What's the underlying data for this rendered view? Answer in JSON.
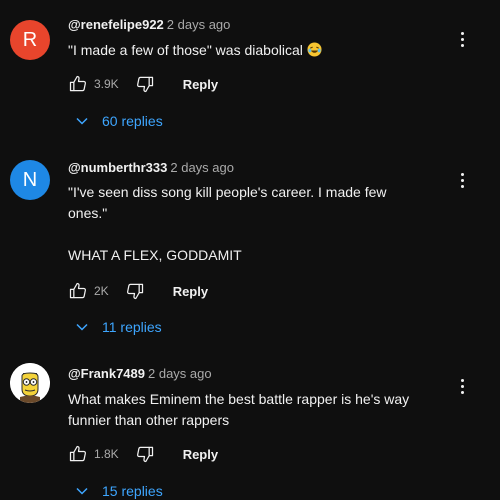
{
  "comments": [
    {
      "avatar_letter": "R",
      "avatar_color": "#e8452c",
      "handle": "@renefelipe922",
      "time": "2 days ago",
      "text_lines": [
        "\"I made a few of those\" was diabolical"
      ],
      "emoji": "laughing-face-icon",
      "likes": "3.9K",
      "reply_label": "Reply",
      "replies_label": "60 replies"
    },
    {
      "avatar_letter": "N",
      "avatar_color": "#1e88e5",
      "handle": "@numberthr333",
      "time": "2 days ago",
      "text_lines": [
        "\"I've seen diss song kill people's career. I made few",
        "ones.\""
      ],
      "text_extra": "WHAT A FLEX, GODDAMIT",
      "likes": "2K",
      "reply_label": "Reply",
      "replies_label": "11 replies"
    },
    {
      "avatar_image": "cartoon-character-avatar",
      "handle": "@Frank7489",
      "time": "2 days ago",
      "text_lines": [
        "What makes Eminem the best battle rapper is he's way",
        "funnier than other rappers"
      ],
      "likes": "1.8K",
      "reply_label": "Reply",
      "replies_label": "15 replies"
    }
  ],
  "colors": {
    "background": "#0f0f0f",
    "link_blue": "#3ea6ff",
    "muted_text": "#aaaaaa"
  }
}
